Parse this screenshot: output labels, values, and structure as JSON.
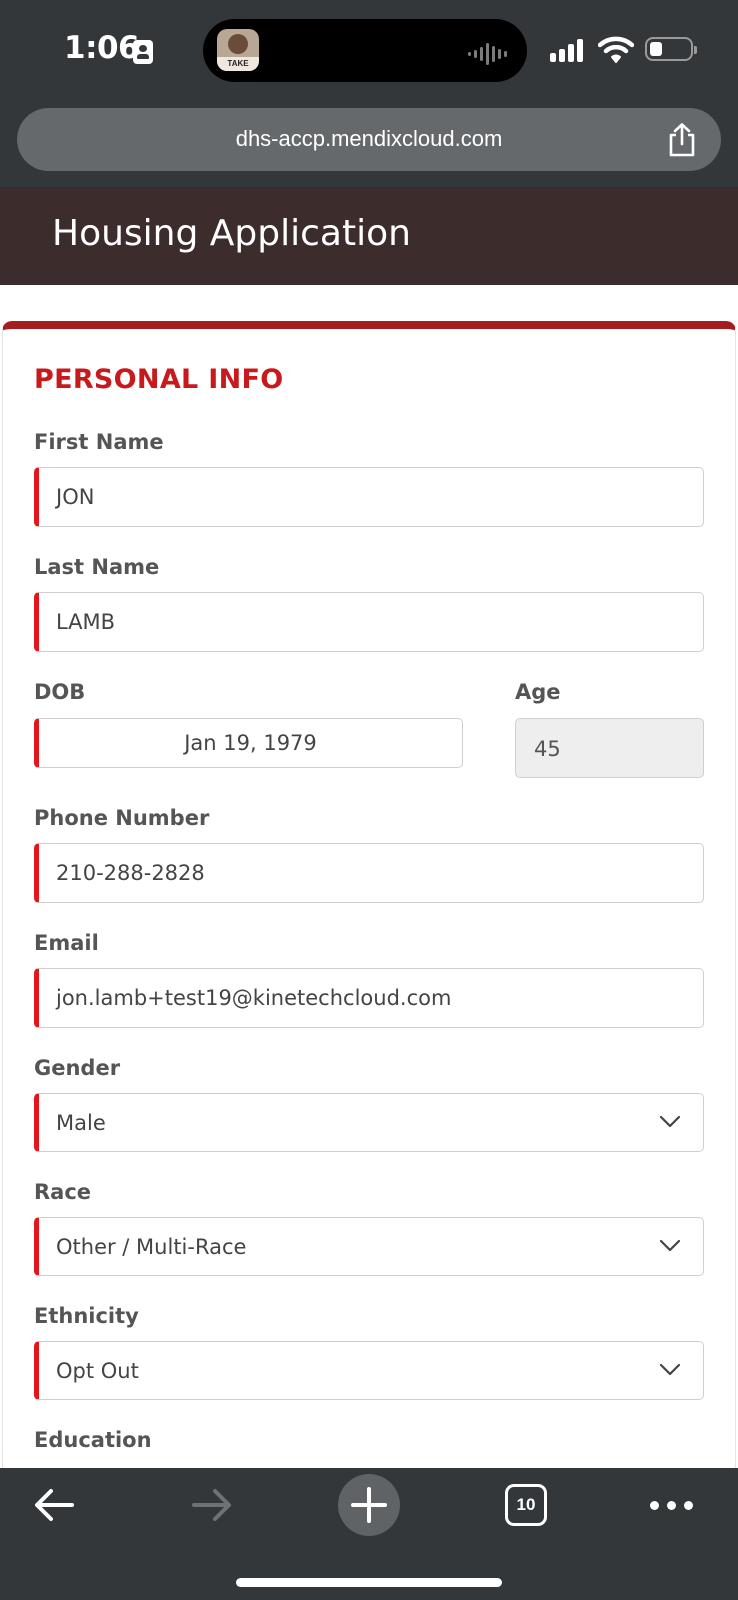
{
  "status_bar": {
    "time": "1:06",
    "island_art_text": "TAKE"
  },
  "browser": {
    "url": "dhs-accp.mendixcloud.com",
    "tab_count": "10"
  },
  "page": {
    "title": "Housing Application",
    "section_title": "PERSONAL INFO"
  },
  "form": {
    "first_name": {
      "label": "First Name",
      "value": "JON"
    },
    "last_name": {
      "label": "Last Name",
      "value": "LAMB"
    },
    "dob": {
      "label": "DOB",
      "value": "Jan 19, 1979"
    },
    "age": {
      "label": "Age",
      "value": "45"
    },
    "phone": {
      "label": "Phone Number",
      "value": "210-288-2828"
    },
    "email": {
      "label": "Email",
      "value": "jon.lamb+test19@kinetechcloud.com"
    },
    "gender": {
      "label": "Gender",
      "value": "Male"
    },
    "race": {
      "label": "Race",
      "value": "Other / Multi-Race"
    },
    "ethnicity": {
      "label": "Ethnicity",
      "value": "Opt Out"
    },
    "education": {
      "label": "Education"
    }
  },
  "colors": {
    "accent_red": "#c8191d",
    "required_bar": "#e5161b",
    "title_bar_bg": "#3d2c2c",
    "chrome_bg": "#33373a"
  }
}
